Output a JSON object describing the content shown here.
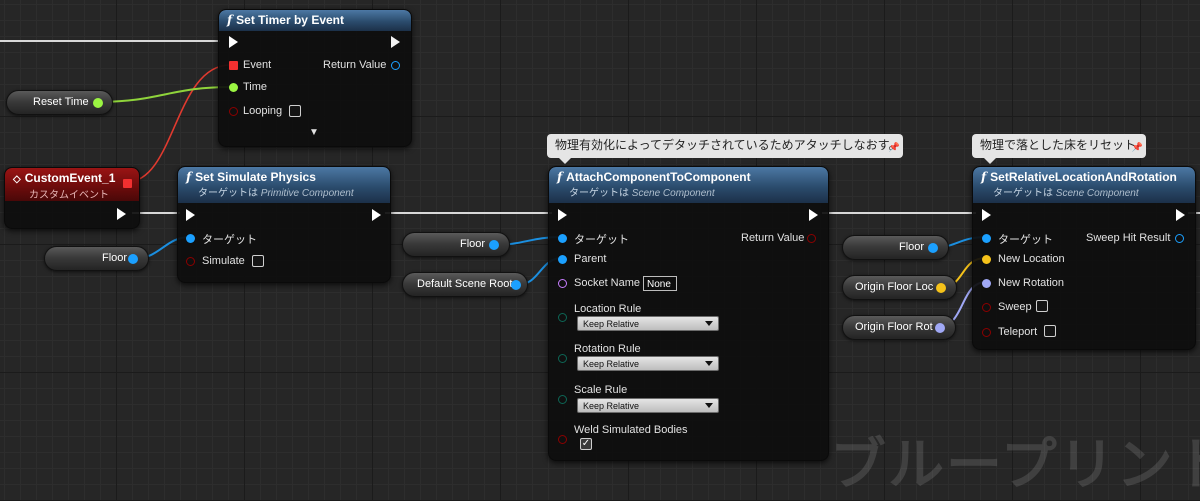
{
  "colors": {
    "exec": "#ffffff",
    "object_pin": "#1ba0ff",
    "float_pin": "#9bf542",
    "bool_pin": "#8c0000",
    "delegate_pin": "#f23030",
    "vector_pin": "#f5c21a",
    "rotator_pin": "#a0a8f5",
    "name_pin": "#c77dff",
    "enum_pin": "#0d6655"
  },
  "watermark": "ブループリント",
  "set_timer": {
    "title": "Set Timer by Event",
    "icon": "function-icon",
    "event": "Event",
    "time": "Time",
    "looping": "Looping",
    "return_value": "Return Value",
    "expand_icon": "▼"
  },
  "reset_time": {
    "label": "Reset Time"
  },
  "custom_event": {
    "title": "CustomEvent_1",
    "subtitle": "カスタムイベント",
    "icon": "event-diamond-icon"
  },
  "simulate": {
    "title": "Set Simulate Physics",
    "target_prefix": "ターゲットは",
    "target_class": "Primitive Component",
    "target_pin": "ターゲット",
    "simulate": "Simulate"
  },
  "floor_vars": [
    "Floor",
    "Floor",
    "Floor"
  ],
  "default_scene_root": {
    "label": "Default Scene Root"
  },
  "attach": {
    "comment": "物理有効化によってデタッチされているためアタッチしなおす。",
    "title": "AttachComponentToComponent",
    "target_prefix": "ターゲットは",
    "target_class": "Scene Component",
    "target_pin": "ターゲット",
    "parent": "Parent",
    "socket_name": "Socket Name",
    "socket_value": "None",
    "location_rule": "Location Rule",
    "location_value": "Keep Relative",
    "rotation_rule": "Rotation Rule",
    "rotation_value": "Keep Relative",
    "scale_rule": "Scale Rule",
    "scale_value": "Keep Relative",
    "weld": "Weld Simulated Bodies",
    "return_value": "Return Value"
  },
  "origin_loc": {
    "label": "Origin Floor Loc"
  },
  "origin_rot": {
    "label": "Origin Floor Rot"
  },
  "set_relative": {
    "comment": "物理で落とした床をリセット",
    "title": "SetRelativeLocationAndRotation",
    "target_prefix": "ターゲットは",
    "target_class": "Scene Component",
    "target_pin": "ターゲット",
    "new_location": "New Location",
    "new_rotation": "New Rotation",
    "sweep": "Sweep",
    "teleport": "Teleport",
    "sweep_hit_result": "Sweep Hit Result"
  }
}
